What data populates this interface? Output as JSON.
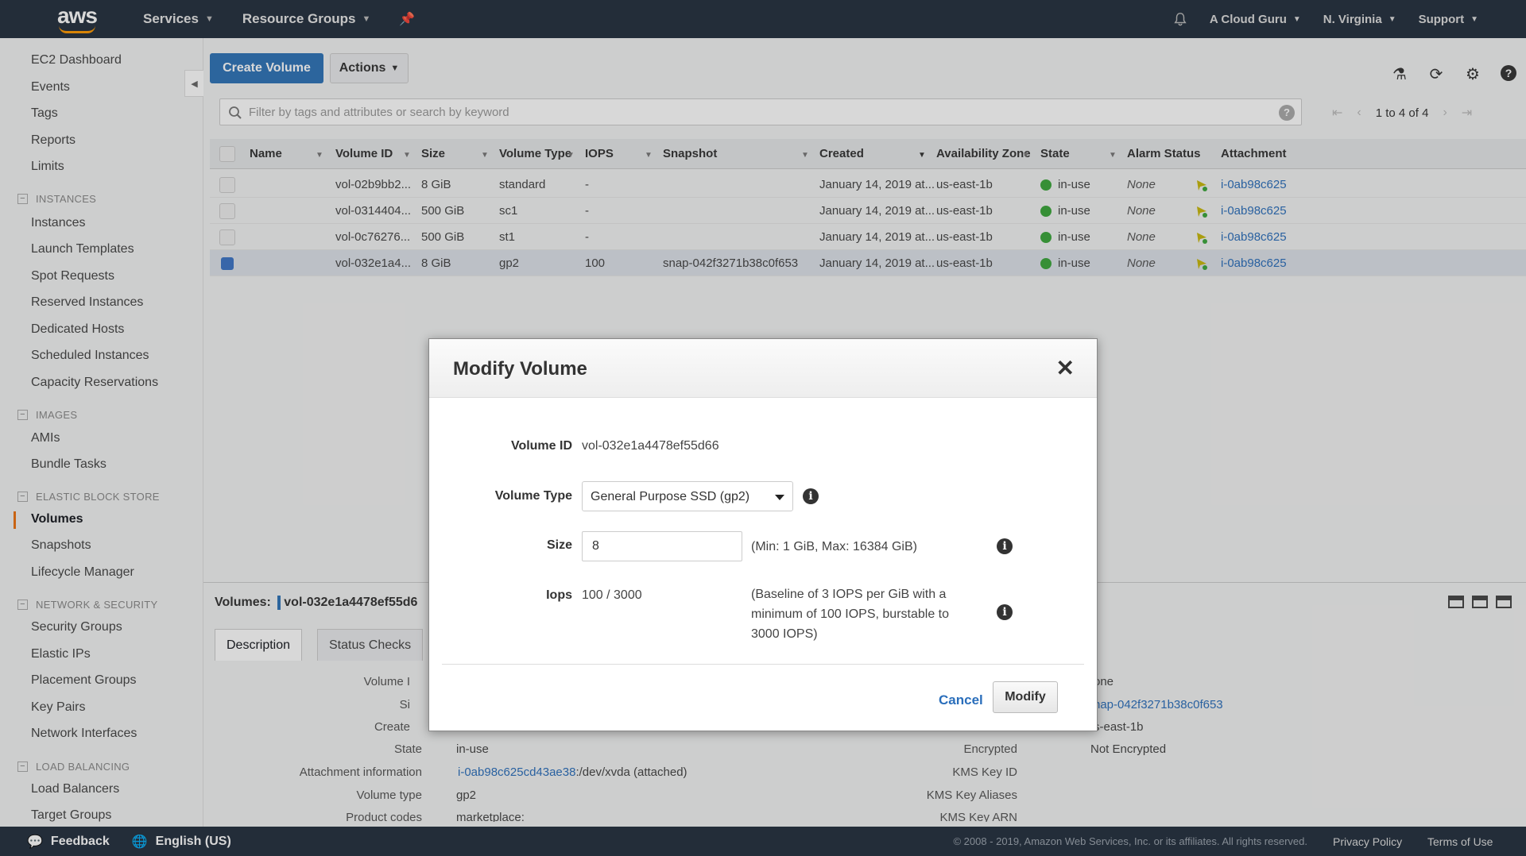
{
  "topnav": {
    "logo_text": "aws",
    "services": "Services",
    "resource_groups": "Resource Groups",
    "account": "A Cloud Guru",
    "region": "N. Virginia",
    "support": "Support"
  },
  "sidebar": {
    "items": [
      {
        "label": "EC2 Dashboard"
      },
      {
        "label": "Events"
      },
      {
        "label": "Tags"
      },
      {
        "label": "Reports"
      },
      {
        "label": "Limits"
      }
    ],
    "instances_header": "INSTANCES",
    "instances": [
      {
        "label": "Instances"
      },
      {
        "label": "Launch Templates"
      },
      {
        "label": "Spot Requests"
      },
      {
        "label": "Reserved Instances"
      },
      {
        "label": "Dedicated Hosts"
      },
      {
        "label": "Scheduled Instances"
      },
      {
        "label": "Capacity Reservations"
      }
    ],
    "images_header": "IMAGES",
    "images": [
      {
        "label": "AMIs"
      },
      {
        "label": "Bundle Tasks"
      }
    ],
    "ebs_header": "ELASTIC BLOCK STORE",
    "ebs": [
      {
        "label": "Volumes"
      },
      {
        "label": "Snapshots"
      },
      {
        "label": "Lifecycle Manager"
      }
    ],
    "net_header": "NETWORK & SECURITY",
    "net": [
      {
        "label": "Security Groups"
      },
      {
        "label": "Elastic IPs"
      },
      {
        "label": "Placement Groups"
      },
      {
        "label": "Key Pairs"
      },
      {
        "label": "Network Interfaces"
      }
    ],
    "lb_header": "LOAD BALANCING",
    "lb": [
      {
        "label": "Load Balancers"
      },
      {
        "label": "Target Groups"
      }
    ]
  },
  "toolbar": {
    "create_label": "Create Volume",
    "actions_label": "Actions"
  },
  "filter": {
    "placeholder": "Filter by tags and attributes or search by keyword",
    "pager_text": "1 to 4 of 4"
  },
  "table": {
    "columns": [
      "Name",
      "Volume ID",
      "Size",
      "Volume Type",
      "IOPS",
      "Snapshot",
      "Created",
      "Availability Zone",
      "State",
      "Alarm Status",
      "Attachment"
    ],
    "rows": [
      {
        "volume_id": "vol-02b9bb2...",
        "size": "8 GiB",
        "type": "standard",
        "iops": "-",
        "snapshot": "",
        "created": "January 14, 2019 at...",
        "az": "us-east-1b",
        "state": "in-use",
        "alarm": "None",
        "attachment": "i-0ab98c625",
        "selected": false
      },
      {
        "volume_id": "vol-0314404...",
        "size": "500 GiB",
        "type": "sc1",
        "iops": "-",
        "snapshot": "",
        "created": "January 14, 2019 at...",
        "az": "us-east-1b",
        "state": "in-use",
        "alarm": "None",
        "attachment": "i-0ab98c625",
        "selected": false
      },
      {
        "volume_id": "vol-0c76276...",
        "size": "500 GiB",
        "type": "st1",
        "iops": "-",
        "snapshot": "",
        "created": "January 14, 2019 at...",
        "az": "us-east-1b",
        "state": "in-use",
        "alarm": "None",
        "attachment": "i-0ab98c625",
        "selected": false
      },
      {
        "volume_id": "vol-032e1a4...",
        "size": "8 GiB",
        "type": "gp2",
        "iops": "100",
        "snapshot": "snap-042f3271b38c0f653",
        "created": "January 14, 2019 at...",
        "az": "us-east-1b",
        "state": "in-use",
        "alarm": "None",
        "attachment": "i-0ab98c625",
        "selected": true
      }
    ]
  },
  "lower": {
    "volumes_label": "Volumes:",
    "selected_volume": "vol-032e1a4478ef55d6",
    "tabs": [
      "Description",
      "Status Checks"
    ],
    "left_labels": {
      "volume": "Volume I",
      "size": "Si",
      "created": "Create",
      "state": "State",
      "attachment": "Attachment information",
      "volume_type": "Volume type",
      "product": "Product codes"
    },
    "state": "in-use",
    "attachment_link": "i-0ab98c625cd43ae38",
    "attachment_rest": ":/dev/xvda (attached)",
    "volume_type": "gp2",
    "product": "marketplace:",
    "right_labels": {
      "encrypted": "Encrypted",
      "kms_id": "KMS Key ID",
      "kms_aliases": "KMS Key Aliases",
      "kms_arn": "KMS Key ARN"
    },
    "right_top_1": "one",
    "right_snapshot": "nap-042f3271b38c0f653",
    "right_az": "s-east-1b",
    "encrypted_value": "Not Encrypted"
  },
  "modal": {
    "title": "Modify Volume",
    "volume_id_label": "Volume ID",
    "volume_id": "vol-032e1a4478ef55d66",
    "volume_type_label": "Volume Type",
    "volume_type": "General Purpose SSD (gp2)",
    "size_label": "Size",
    "size_value": "8",
    "size_hint": "(Min: 1 GiB, Max: 16384 GiB)",
    "iops_label": "Iops",
    "iops_value": "100 / 3000",
    "iops_hint": [
      "(Baseline of 3 IOPS per GiB with a",
      "minimum of 100 IOPS, burstable to",
      "3000 IOPS)"
    ],
    "cancel_label": "Cancel",
    "modify_label": "Modify"
  },
  "footer": {
    "feedback": "Feedback",
    "language": "English (US)",
    "copyright": "© 2008 - 2019, Amazon Web Services, Inc. or its affiliates. All rights reserved.",
    "privacy": "Privacy Policy",
    "terms": "Terms of Use"
  }
}
